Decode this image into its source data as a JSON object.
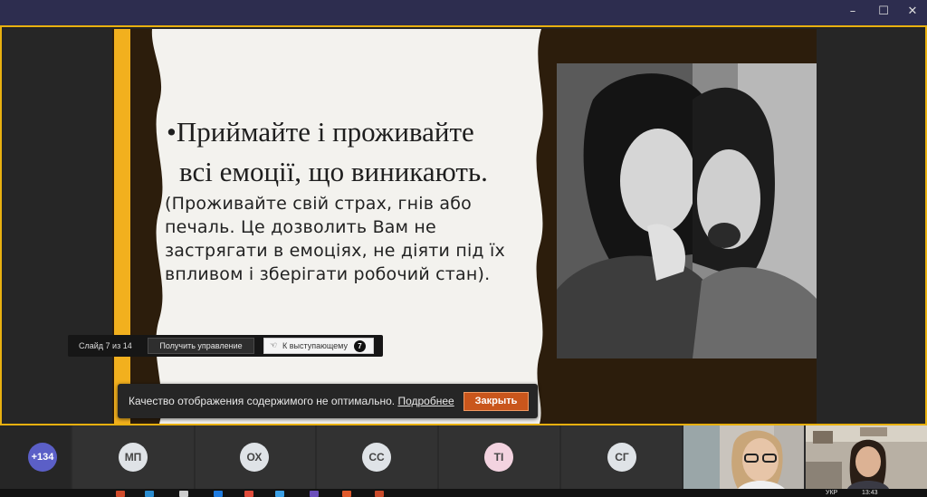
{
  "window": {
    "controls": [
      "–",
      "☐",
      "✕"
    ]
  },
  "slide": {
    "bullet_line1": "•Приймайте і проживайте",
    "bullet_line2": "всі емоції, що виникають.",
    "body": "(Проживайте свій страх, гнів або печаль. Це дозволить Вам не застрягати в емоціях, не діяти під їх впливом і зберігати робочий стан)."
  },
  "presenter_bar": {
    "slide_counter": "Слайд 7 из 14",
    "take_control_label": "Получить управление",
    "to_presenter_label": "К выступающему",
    "to_presenter_hand": "☜",
    "shortcut_badge": "7"
  },
  "notification": {
    "message": "Качество отображения содержимого не оптимально.",
    "link_label": "Подробнее",
    "close_label": "Закрыть"
  },
  "participants": [
    {
      "initials": "+134"
    },
    {
      "initials": "МП"
    },
    {
      "initials": "ОХ"
    },
    {
      "initials": "СС"
    },
    {
      "initials": "TI"
    },
    {
      "initials": "СГ"
    }
  ],
  "taskbar": {
    "language": "УКР",
    "time": "13:43"
  },
  "colors": {
    "accent_yellow": "#e8b00f",
    "slide_brown": "#2c1d0c",
    "close_orange": "#c9561c",
    "more_avatar": "#5b5fc7"
  }
}
